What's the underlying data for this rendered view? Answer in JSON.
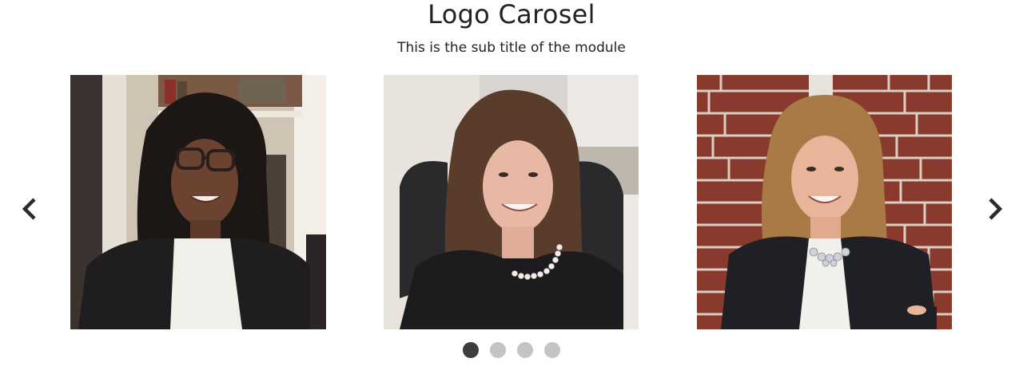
{
  "module": {
    "title": "Logo Carosel",
    "subtitle": "This is the sub title of the module"
  },
  "navigation": {
    "prev_icon": "chevron-left-icon",
    "next_icon": "chevron-right-icon",
    "icon_color": "#2b2b2b"
  },
  "slides": [
    {
      "image": "portrait-woman-glasses-bookshelf"
    },
    {
      "image": "portrait-woman-pearl-necklace-office"
    },
    {
      "image": "portrait-woman-brick-wall"
    }
  ],
  "pagination": {
    "count": 4,
    "active_index": 0,
    "active_color": "#3d3d3d",
    "inactive_color": "#c4c4c4"
  }
}
